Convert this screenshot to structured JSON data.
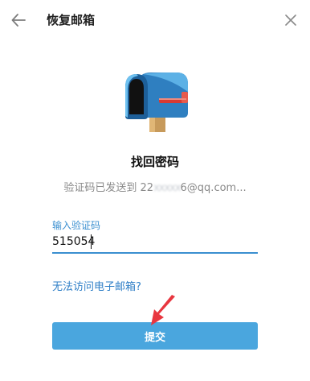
{
  "header": {
    "title": "恢复邮箱",
    "back_icon": "arrow-left-icon",
    "close_icon": "close-icon"
  },
  "illustration": {
    "icon": "mailbox-icon"
  },
  "main": {
    "heading": "找回密码",
    "sent_prefix": "验证码已发送到 22",
    "email_masked": "xxxxx",
    "email_suffix": "6@qq.com..."
  },
  "form": {
    "code_label": "输入验证码",
    "code_value": "515054",
    "help_link": "无法访问电子邮箱?",
    "submit_label": "提交"
  },
  "colors": {
    "accent": "#3a8fd0",
    "button": "#4aa6de",
    "link": "#2f7fc7",
    "pointer_arrow": "#e8363f"
  }
}
